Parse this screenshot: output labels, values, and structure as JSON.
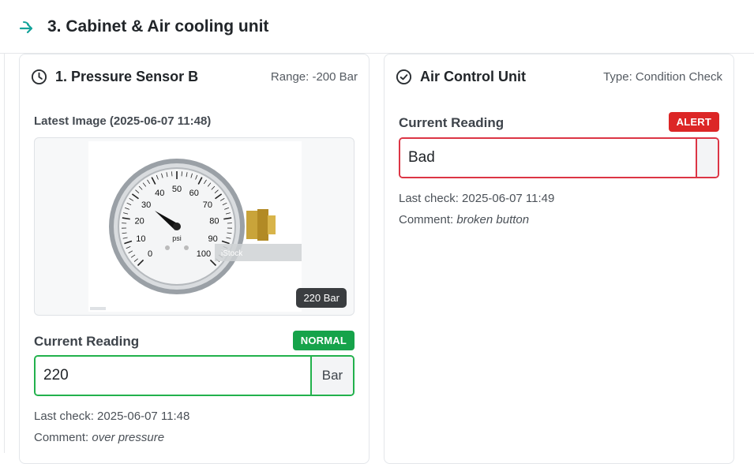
{
  "section": {
    "title": "3. Cabinet & Air cooling unit",
    "icon": "arrow-right-icon",
    "accent": "#14a39a"
  },
  "cards": [
    {
      "title": "1. Pressure Sensor B",
      "meta": "Range: -200 Bar",
      "icon": "clock-icon",
      "latest_image_label": "Latest Image (2025-06-07 11:48)",
      "image_badge": "220 Bar",
      "gauge": {
        "tick_labels": [
          "0",
          "10",
          "20",
          "30",
          "40",
          "50",
          "60",
          "70",
          "80",
          "90",
          "100"
        ],
        "unit": "psi",
        "watermark": "iStock"
      },
      "reading_label": "Current Reading",
      "status": "NORMAL",
      "status_color": "#16a34a",
      "value": "220",
      "unit": "Bar",
      "last_check": "Last check: 2025-06-07 11:48",
      "comment_label": "Comment:",
      "comment": "over pressure"
    },
    {
      "title": "Air Control Unit",
      "meta": "Type: Condition Check",
      "icon": "check-circle-icon",
      "reading_label": "Current Reading",
      "status": "ALERT",
      "status_color": "#dc2626",
      "value": "Bad",
      "last_check": "Last check: 2025-06-07 11:49",
      "comment_label": "Comment:",
      "comment": "broken button"
    }
  ]
}
